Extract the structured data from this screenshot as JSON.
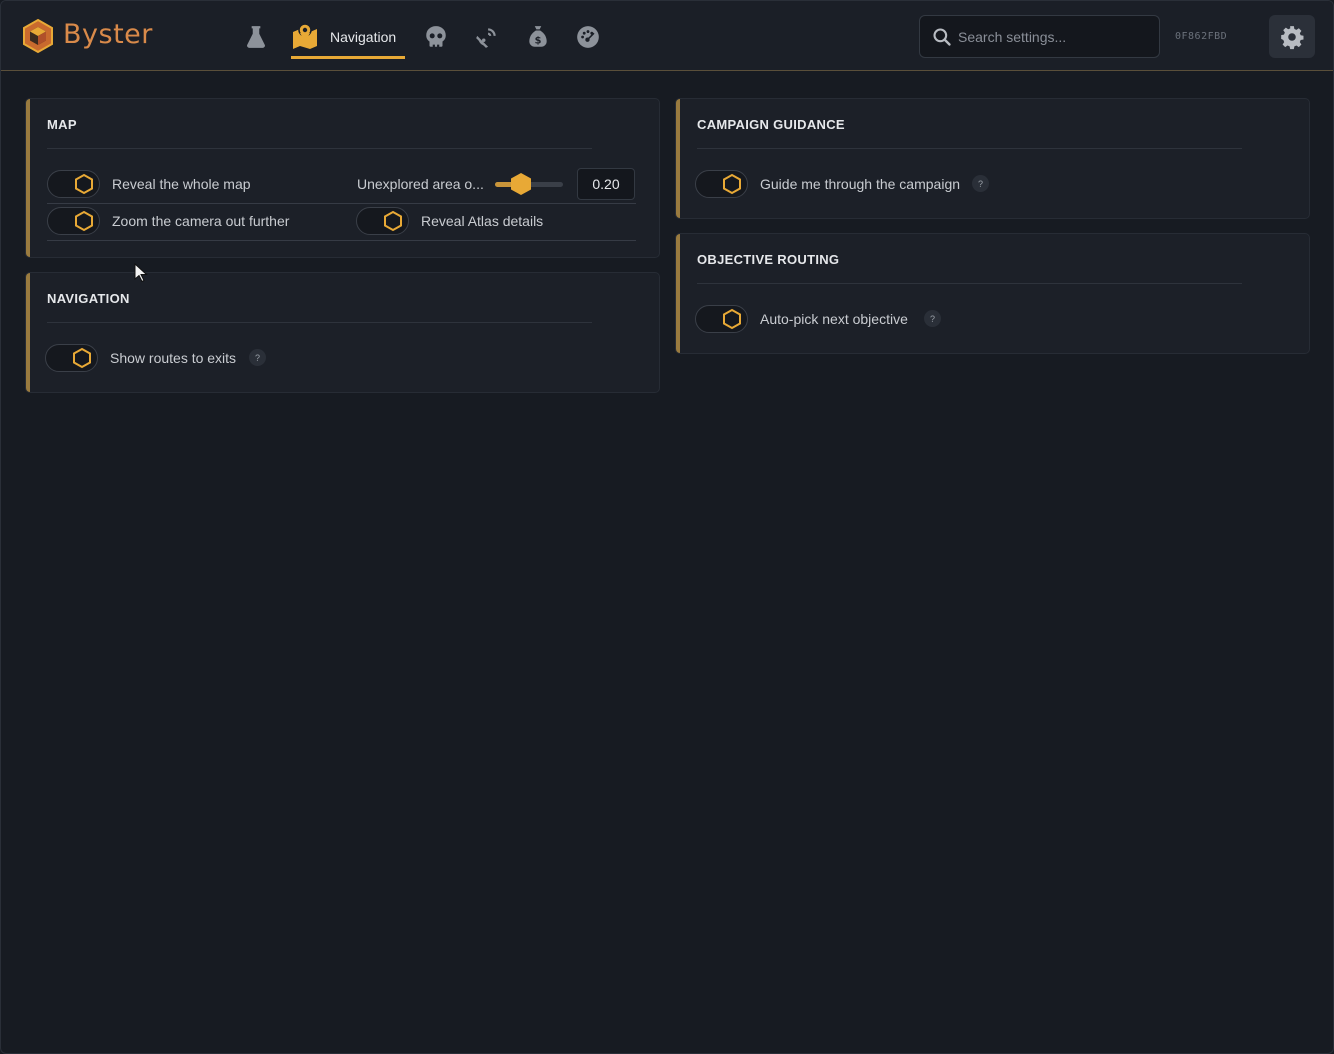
{
  "app": {
    "brand": "Byster",
    "hwid": "0F862FBD"
  },
  "nav": {
    "active": {
      "label": "Navigation",
      "icon": "map-pin-icon"
    },
    "icons": [
      "flask-icon",
      "skull-icon",
      "satellite-icon",
      "money-bag-icon",
      "dashboard-icon"
    ]
  },
  "search": {
    "placeholder": "Search settings...",
    "value": ""
  },
  "colors": {
    "accent": "#e8a936",
    "panel_bar": "#9a7b3f",
    "background": "#171b22"
  },
  "panels": {
    "map": {
      "title": "MAP",
      "reveal_map": {
        "label": "Reveal the whole map",
        "on": false
      },
      "unexplored": {
        "label": "Unexplored area o...",
        "value": "0.20",
        "fraction": 0.2
      },
      "zoom_camera": {
        "label": "Zoom the camera out further",
        "on": false
      },
      "reveal_atlas": {
        "label": "Reveal Atlas details",
        "on": false
      }
    },
    "navigation": {
      "title": "NAVIGATION",
      "show_routes": {
        "label": "Show routes to exits",
        "on": false,
        "help": "?"
      }
    },
    "campaign": {
      "title": "CAMPAIGN GUIDANCE",
      "guide": {
        "label": "Guide me through the campaign",
        "on": false,
        "help": "?"
      }
    },
    "objective": {
      "title": "OBJECTIVE ROUTING",
      "auto_pick": {
        "label": "Auto-pick next objective",
        "on": false,
        "help": "?"
      }
    }
  }
}
